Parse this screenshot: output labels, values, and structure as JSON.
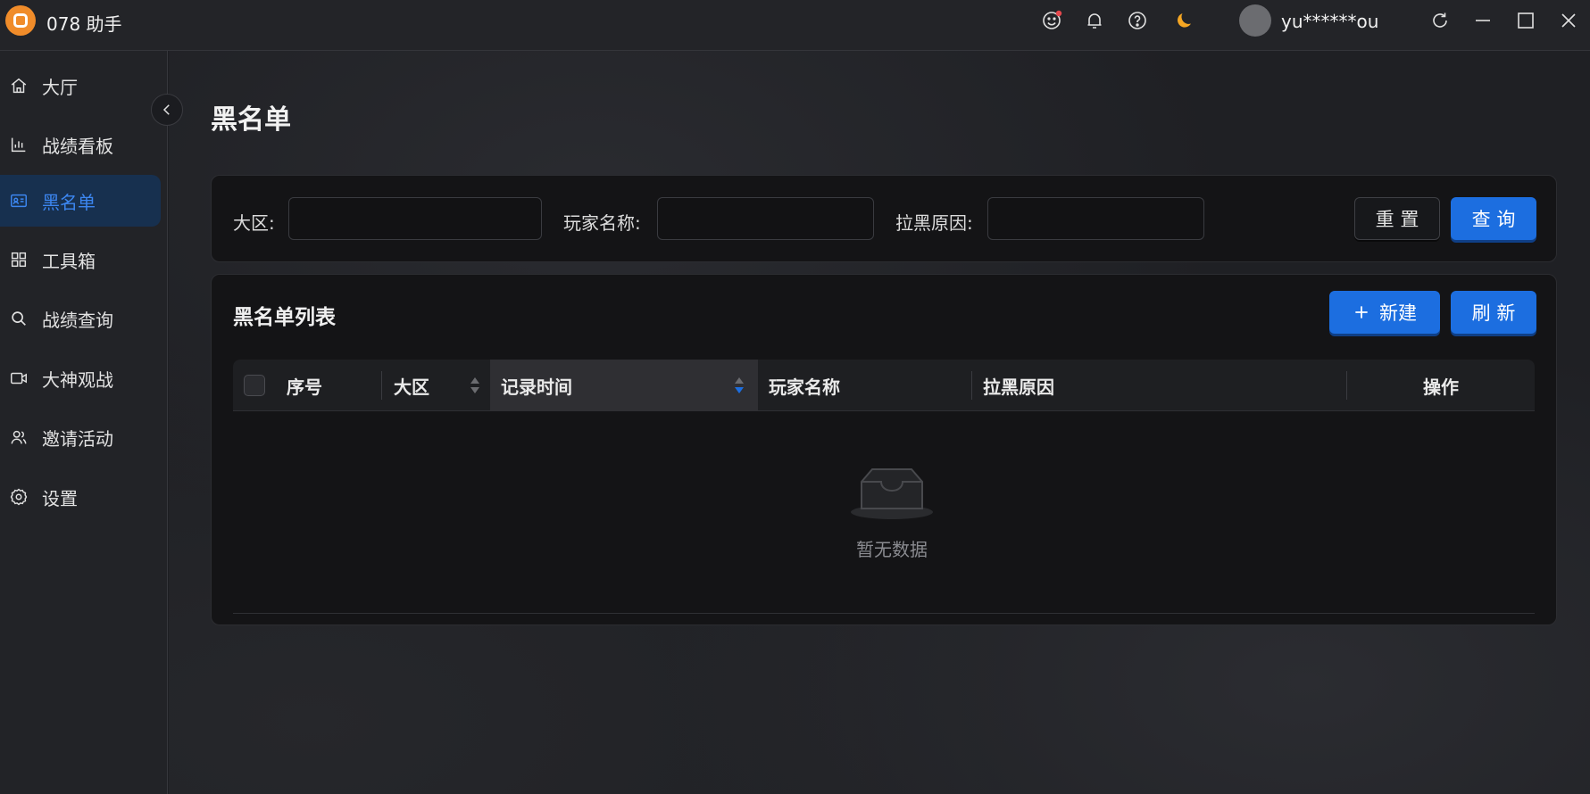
{
  "app": {
    "title": "078 助手"
  },
  "user": {
    "name": "yu******ou"
  },
  "colors": {
    "accent": "#1c6ee0",
    "active_nav_bg": "#17304f",
    "logo": "#f08c2a",
    "moon": "#f5a623",
    "badge": "#e5484d"
  },
  "titlebar_icons": [
    "smile-icon",
    "bell-icon",
    "help-icon",
    "moon-icon",
    "refresh-icon",
    "minimize-icon",
    "maximize-icon",
    "close-icon"
  ],
  "sidebar": {
    "items": [
      {
        "label": "大厅",
        "icon": "home-icon"
      },
      {
        "label": "战绩看板",
        "icon": "chart-icon"
      },
      {
        "label": "黑名单",
        "icon": "id-card-icon",
        "active": true
      },
      {
        "label": "工具箱",
        "icon": "grid-icon"
      },
      {
        "label": "战绩查询",
        "icon": "search-icon"
      },
      {
        "label": "大神观战",
        "icon": "video-icon"
      },
      {
        "label": "邀请活动",
        "icon": "users-icon"
      },
      {
        "label": "设置",
        "icon": "gear-icon"
      }
    ]
  },
  "page": {
    "title": "黑名单"
  },
  "filters": {
    "region_label": "大区:",
    "region_value": "",
    "player_label": "玩家名称:",
    "player_value": "",
    "reason_label": "拉黑原因:",
    "reason_value": "",
    "reset_label": "重 置",
    "query_label": "查 询"
  },
  "list": {
    "title": "黑名单列表",
    "new_label": "新建",
    "refresh_label": "刷 新",
    "columns": [
      "序号",
      "大区",
      "记录时间",
      "玩家名称",
      "拉黑原因",
      "操作"
    ],
    "rows": [],
    "empty_text": "暂无数据"
  }
}
